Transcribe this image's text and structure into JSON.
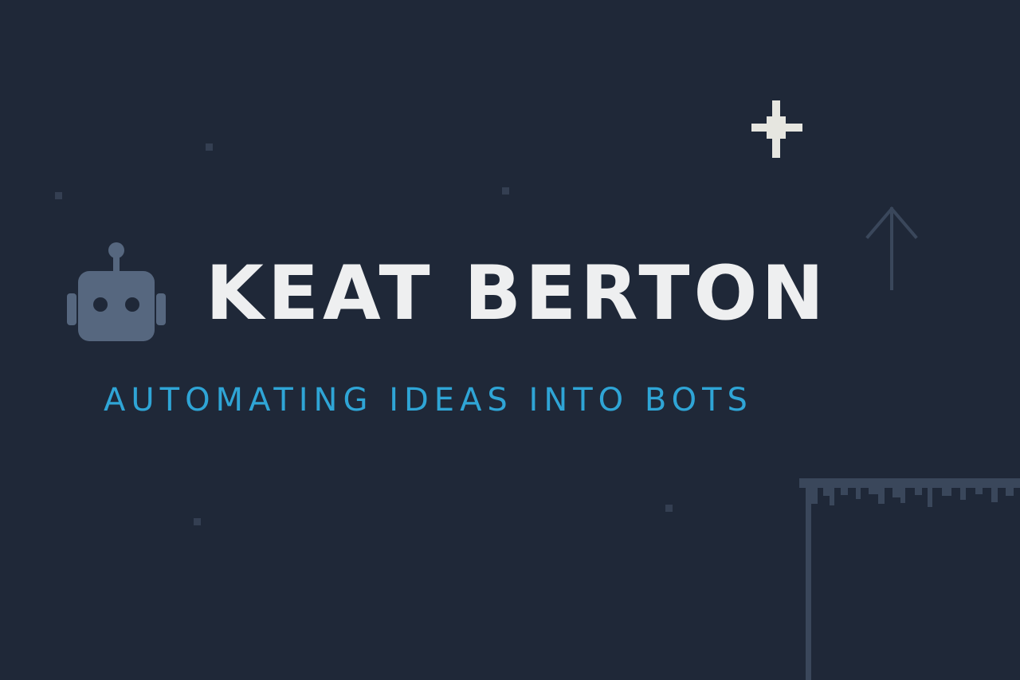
{
  "hero": {
    "title": "KEAT BERTON",
    "tagline": "AUTOMATING IDEAS INTO BOTS"
  },
  "icons": {
    "logo": "robot-icon",
    "sparkle": "sparkle-icon",
    "arrow": "arrow-up-icon"
  },
  "colors": {
    "background": "#1f2838",
    "title": "#eeeff0",
    "tagline": "#2fa5d6",
    "robot": "#56677f",
    "decor": "#3a475b",
    "sparkle": "#e6e6e0"
  }
}
